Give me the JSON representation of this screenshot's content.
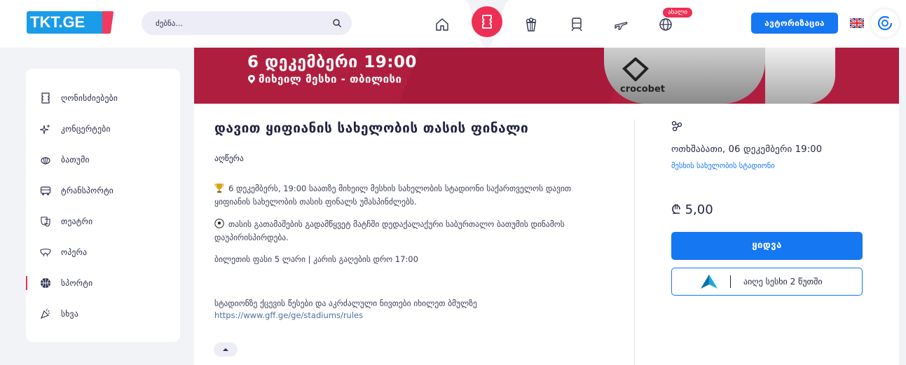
{
  "header": {
    "logo_text": "TKT.GE",
    "search_placeholder": "ძებნა...",
    "new_badge": "ახალი",
    "login_label": "ავტორიზაცია",
    "nav_icons": [
      "home-icon",
      "tickets-icon",
      "popcorn-icon",
      "train-icon",
      "airplane-icon",
      "globe-icon"
    ],
    "accent": "#ee2f54",
    "primary": "#1677f2"
  },
  "sidebar": {
    "items": [
      {
        "label": "ღონისძიებები",
        "icon": "ticket-icon"
      },
      {
        "label": "კონცერტები",
        "icon": "sparkle-icon"
      },
      {
        "label": "ბათუმი",
        "icon": "shell-icon"
      },
      {
        "label": "ტრანსპორტი",
        "icon": "bus-icon"
      },
      {
        "label": "თეატრი",
        "icon": "theater-mask-icon"
      },
      {
        "label": "ოპერა",
        "icon": "opera-mask-icon"
      },
      {
        "label": "სპორტი",
        "icon": "basketball-icon"
      },
      {
        "label": "სხვა",
        "icon": "confetti-icon"
      }
    ],
    "active_index": 6
  },
  "banner": {
    "line1": "6 დეკემბერი 19:00",
    "line2": "მიხეილ მესხი - თბილისი",
    "sponsor": "crocobet"
  },
  "event": {
    "title": "დავით ყიფიანის სახელობის თასის ფინალი",
    "description_label": "აღწერა",
    "paragraph1": "6 დეკემბერს, 19:00 საათზე მიხეილ მესხის სახელობის სტადიონი საქართველოს დავით ყიფიანის სახელობის თასის ფინალს უმასპინძლებს.",
    "paragraph2": "თასის გათამაშების გადამწყვეტ მატჩში დედაქალაქური საბურთალო ბათუმის დინამოს დაუპირისპირდება.",
    "paragraph3": "ბილეთის ფასი 5 ლარი | კარის გაღების დრო 17:00",
    "paragraph4": "სტადიონზე ქცევის წესები და აკრძალული ნივთები იხილეთ ბმულზე",
    "link": "https://www.gff.ge/ge/stadiums/rules"
  },
  "booking": {
    "date": "ოთხშაბათი, 06 დეკემბერი 19:00",
    "venue": "მესხის სახელობის სტადიონი",
    "price": "₾ 5,00",
    "buy_label": "ყიდვა",
    "promo_text": "აიღე სესხი 2 წუთში"
  }
}
